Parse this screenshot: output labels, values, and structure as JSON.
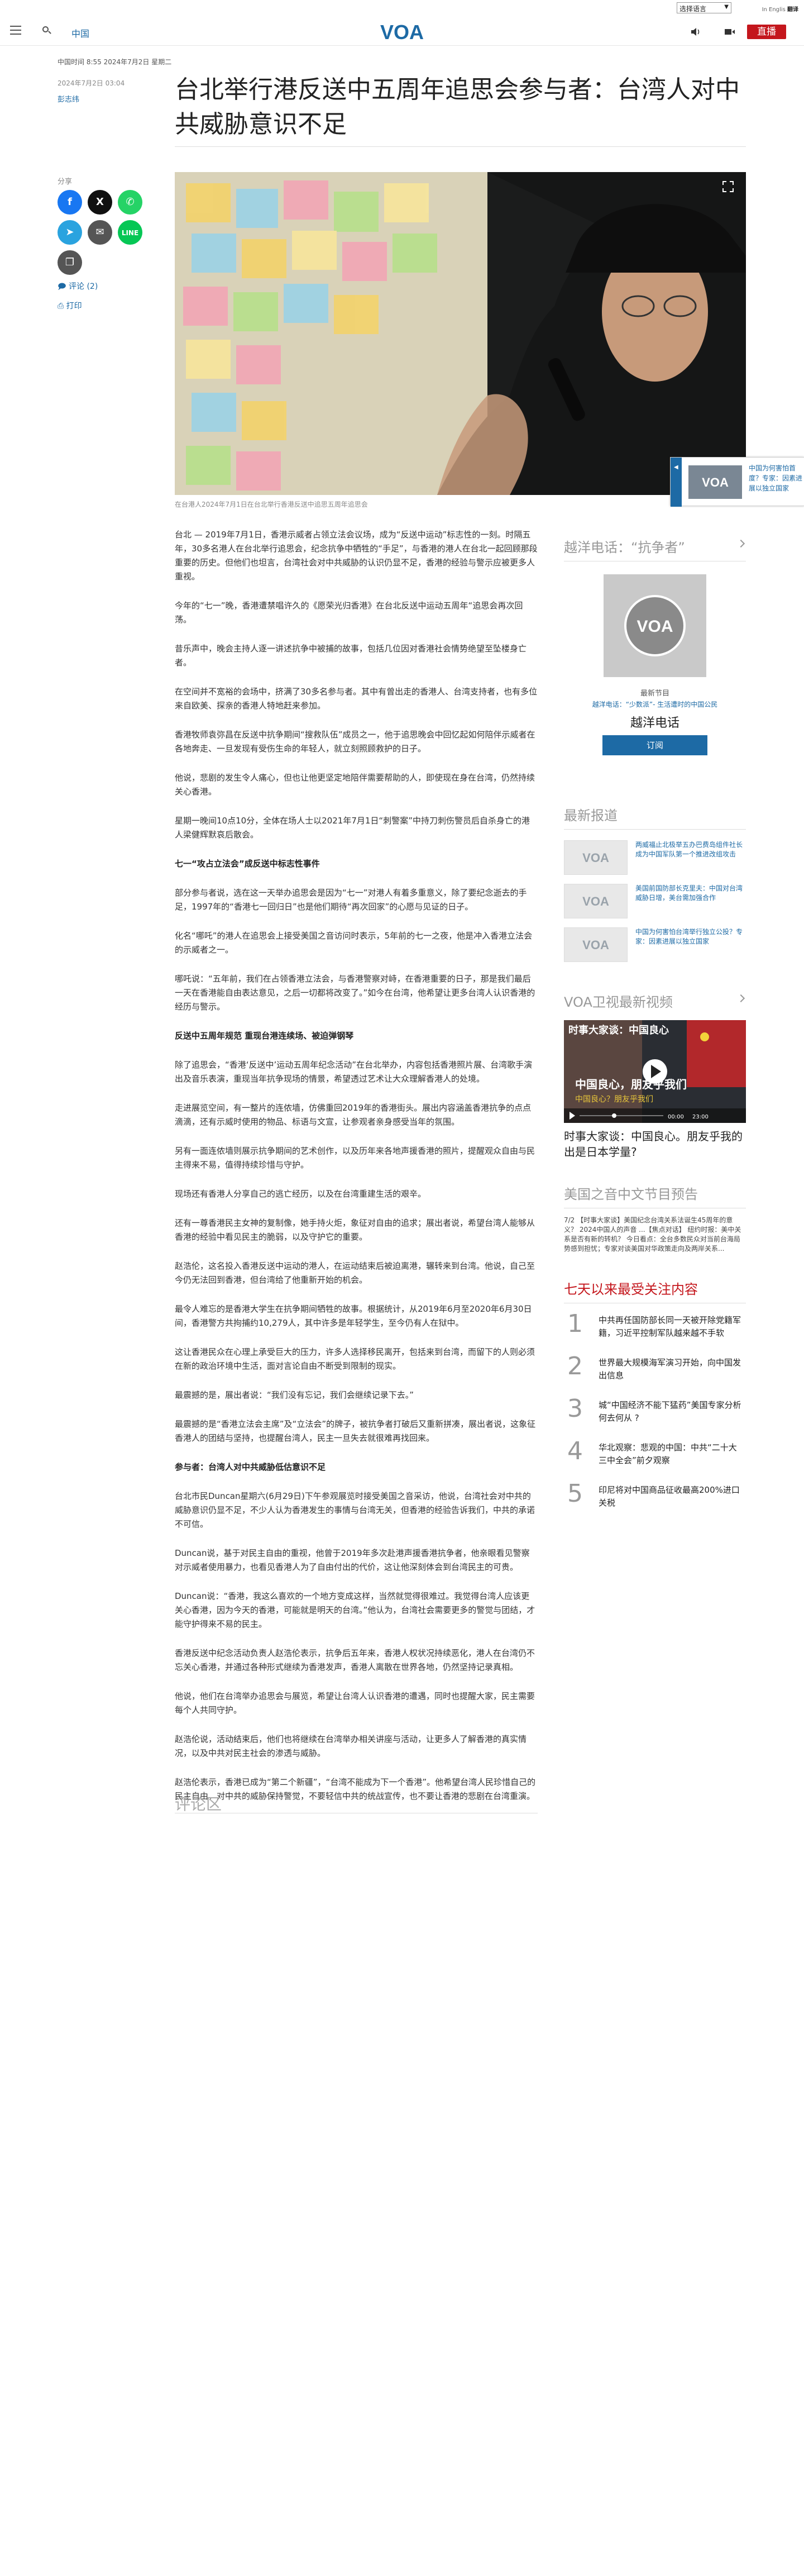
{
  "topbar": {
    "language_select": "选择语言",
    "tiny_links": [
      "In Englis",
      "翻译"
    ]
  },
  "header": {
    "nav_china": "中国",
    "logo_text": "VOA",
    "live_label": "直播"
  },
  "article_meta": {
    "section": "中国时间 8:55 2024年7月2日 星期二",
    "date": "2024年7月2日 03:04",
    "author": "彭志纬",
    "title": "台北举行港反送中五周年追思会参与者：台湾人对中共威胁意识不足"
  },
  "share": {
    "label": "分享",
    "comments": "评论 (2)",
    "print": "打印",
    "buttons": [
      "facebook",
      "x",
      "whatsapp",
      "telegram",
      "email",
      "line",
      "copy-link"
    ]
  },
  "hero": {
    "caption": "在台港人2024年7月1日在台北举行香港反送中追思五周年追思会"
  },
  "float_promo": {
    "text": "中国为何害怕",
    "text_full": "中国为何害怕首度？专家：因素进展以独立国家"
  },
  "article": {
    "paragraphs": [
      {
        "type": "p",
        "text": "台北 — 2019年7月1日，香港示威者占领立法会议场，成为“反送中运动”标志性的一刻。时隔五年，30多名港人在台北举行追思会，纪念抗争中牺牲的“手足”，与香港的港人在台北一起回顾那段重要的历史。但他们也坦言，台湾社会对中共威胁的认识仍显不足，香港的经验与警示应被更多人重视。"
      },
      {
        "type": "p",
        "text": "今年的“七一”晚，香港遭禁唱许久的《愿荣光归香港》在台北反送中运动五周年“追思会再次回荡。"
      },
      {
        "type": "p",
        "text": "昔乐声中，晚会主持人逐一讲述抗争中被捕的故事，包括几位因对香港社会情势绝望至坠楼身亡者。"
      },
      {
        "type": "p",
        "text": "在空间并不宽裕的会场中，挤满了30多名参与者。其中有曾出走的香港人、台湾支持者，也有多位来自欧美、探亲的香港人特地赶来参加。"
      },
      {
        "type": "p",
        "text": "香港牧师袁弥昌在反送中抗争期间“搜救队伍”成员之一，他于追思晚会中回忆起如何陪伴示威者在各地奔走、一旦发现有受伤生命的年轻人，就立刻照顾救护的日子。"
      },
      {
        "type": "p",
        "text": "他说，悲剧的发生令人痛心，但也让他更坚定地陪伴需要帮助的人，即使现在身在台湾，仍然持续关心香港。"
      },
      {
        "type": "p",
        "text": "星期一晚间10点10分，全体在场人士以2021年7月1日“刺警案”中持刀刺伤警员后自杀身亡的港人梁健辉默哀后散会。"
      },
      {
        "type": "h3",
        "text": "七一“攻占立法会”成反送中标志性事件"
      },
      {
        "type": "p",
        "text": "部分参与者说，选在这一天举办追思会是因为“七一”对港人有着多重意义，除了要纪念逝去的手足，1997年的“香港七一回归日”也是他们期待“再次回家”的心愿与见证的日子。"
      },
      {
        "type": "p",
        "text": "化名“哪吒”的港人在追思会上接受美国之音访问时表示，5年前的七一之夜，他是冲入香港立法会的示威者之一。"
      },
      {
        "type": "p",
        "text": "哪吒说：“五年前，我们在占领香港立法会，与香港警察对峙，在香港重要的日子，那是我们最后一天在香港能自由表达意见，之后一切都将改变了。”如今在台湾，他希望让更多台湾人认识香港的经历与警示。"
      },
      {
        "type": "h3",
        "text": "反送中五周年规范 重现台港连续场、被迫弹钢琴"
      },
      {
        "type": "p",
        "text": "除了追思会，“香港‘反送中’运动五周年纪念活动”在台北举办，内容包括香港照片展、台湾歌手演出及音乐表演，重现当年抗争现场的情景，希望透过艺术让大众理解香港人的处境。"
      },
      {
        "type": "p",
        "text": "走进展览空间，有一整片的连侬墙，仿佛重回2019年的香港街头。展出内容涵盖香港抗争的点点滴滴，还有示威时使用的物品、标语与文宣，让参观者亲身感受当年的氛围。"
      },
      {
        "type": "p",
        "text": "另有一面连侬墙则展示抗争期间的艺术创作，以及历年来各地声援香港的照片，提醒观众自由与民主得来不易，值得持续珍惜与守护。"
      },
      {
        "type": "p",
        "text": "现场还有香港人分享自己的逃亡经历，以及在台湾重建生活的艰辛。"
      },
      {
        "type": "p",
        "text": "还有一尊香港民主女神的复制像，她手持火炬，象征对自由的追求；展出者说，希望台湾人能够从香港的经验中看见民主的脆弱，以及守护它的重要。"
      },
      {
        "type": "p",
        "text": "赵浩伦，这名投入香港反送中运动的港人，在运动结束后被迫离港，辗转来到台湾。他说，自己至今仍无法回到香港，但台湾给了他重新开始的机会。"
      },
      {
        "type": "p",
        "text": "最令人难忘的是香港大学生在抗争期间牺牲的故事。根据统计，从2019年6月至2020年6月30日间，香港警方共拘捕约10,279人，其中许多是年轻学生，至今仍有人在狱中。"
      },
      {
        "type": "p",
        "text": "这让香港民众在心理上承受巨大的压力，许多人选择移民离开，包括来到台湾，而留下的人则必须在新的政治环境中生活，面对言论自由不断受到限制的现实。"
      },
      {
        "type": "p",
        "text": "最震撼的是，展出者说：“我们没有忘记，我们会继续记录下去。”"
      },
      {
        "type": "p",
        "text": "最震撼的是“香港立法会主席”及“立法会”的牌子，被抗争者打破后又重新拼凑，展出者说，这象征香港人的团结与坚持，也提醒台湾人，民主一旦失去就很难再找回来。"
      },
      {
        "type": "h3",
        "text": "参与者：台湾人对中共威胁低估意识不足"
      },
      {
        "type": "p",
        "text": "台北市民Duncan星期六(6月29日)下午参观展览时接受美国之音采访，他说，台湾社会对中共的威胁意识仍显不足，不少人认为香港发生的事情与台湾无关，但香港的经验告诉我们，中共的承诺不可信。"
      },
      {
        "type": "p",
        "text": "Duncan说，基于对民主自由的重视，他曾于2019年多次赴港声援香港抗争者，他亲眼看见警察对示威者使用暴力，也看见香港人为了自由付出的代价，这让他深刻体会到台湾民主的可贵。"
      },
      {
        "type": "p",
        "text": "Duncan说：“香港，我这么喜欢的一个地方变成这样，当然就觉得很难过。我觉得台湾人应该更关心香港，因为今天的香港，可能就是明天的台湾。”他认为，台湾社会需要更多的警觉与团结，才能守护得来不易的民主。"
      },
      {
        "type": "p",
        "text": "香港反送中纪念活动负责人赵浩伦表示，抗争后五年来，香港人权状况持续恶化，港人在台湾仍不忘关心香港，并通过各种形式继续为香港发声，香港人离散在世界各地，仍然坚持记录真相。"
      },
      {
        "type": "p",
        "text": "他说，他们在台湾举办追思会与展览，希望让台湾人认识香港的遭遇，同时也提醒大家，民主需要每个人共同守护。"
      },
      {
        "type": "p",
        "text": "赵浩伦说，活动结束后，他们也将继续在台湾举办相关讲座与活动，让更多人了解香港的真实情况，以及中共对民主社会的渗透与威胁。"
      },
      {
        "type": "p",
        "text": "赵浩伦表示，香港已成为“第二个新疆”，“台湾不能成为下一个香港”。他希望台湾人民珍惜自己的民主自由，对中共的威胁保持警觉，不要轻信中共的统战宣传，也不要让香港的悲剧在台湾重演。"
      }
    ]
  },
  "comments_section": {
    "heading": "评论区"
  },
  "sidebar": {
    "podcast": {
      "heading": "越洋电话：“抗争者”",
      "label": "最新节目",
      "subtitle": "越洋电话：“少数派”- 生活遭时的中国公民",
      "title": "越洋电话",
      "subscribe": "订阅"
    },
    "latest_news": {
      "heading": "最新报道",
      "items": [
        {
          "title": "两威福止北极举五办巴费岛组件社长成为中国军队第一个推进改组攻击"
        },
        {
          "title": "美国前国防部长克里夫：中国对台湾威胁日增，美台需加强合作"
        },
        {
          "title": "中国为何害怕台湾举行独立公投？专家：因素进展以独立国家"
        }
      ]
    },
    "video": {
      "heading": "VOA卫视最新视频",
      "overlay_top": "时事大家谈：中国良心",
      "overlay_mid": "中国良心，朋友乎我们",
      "overlay_bottom": "中国良心？朋友乎我们",
      "time": "00:00",
      "duration": "23:00",
      "title": "时事大家谈：中国良心。朋友乎我的出是日本学量?"
    },
    "programs": {
      "heading": "美国之音中文节目预告",
      "text": "7/2 【时事大家谈】美国纪念台湾关系法诞生45周年的意义？ 2024中国人的声音 ...【焦点对话】 纽约时报：美中关系是否有新的转机？ 今日看点：全台多数民众对当前台海局势感到担忧；专家对谈美国对华政策走向及两岸关系..."
    },
    "popular": {
      "heading": "七天以来最受关注内容",
      "items": [
        {
          "num": "1",
          "title": "中共再任国防部长同一天被开除党籍军籍，习近平控制军队越来越不手软"
        },
        {
          "num": "2",
          "title": "世界最大规模海军演习开始，向中国发出信息"
        },
        {
          "num": "3",
          "title": "城“中国经济不能下猛药”美国专家分析何去何从 ?"
        },
        {
          "num": "4",
          "title": "华北观察：悲观的中国：中共“二十大三中全会”前夕观察"
        },
        {
          "num": "5",
          "title": "印尼将对中国商品征收最高200%进口关税"
        }
      ]
    }
  },
  "colors": {
    "accent": "#1d6aa5",
    "live": "#c4161c",
    "facebook": "#1877f2",
    "x": "#111111",
    "whatsapp": "#25d366",
    "telegram": "#2aa3df",
    "email": "#555555",
    "line": "#06c755"
  }
}
